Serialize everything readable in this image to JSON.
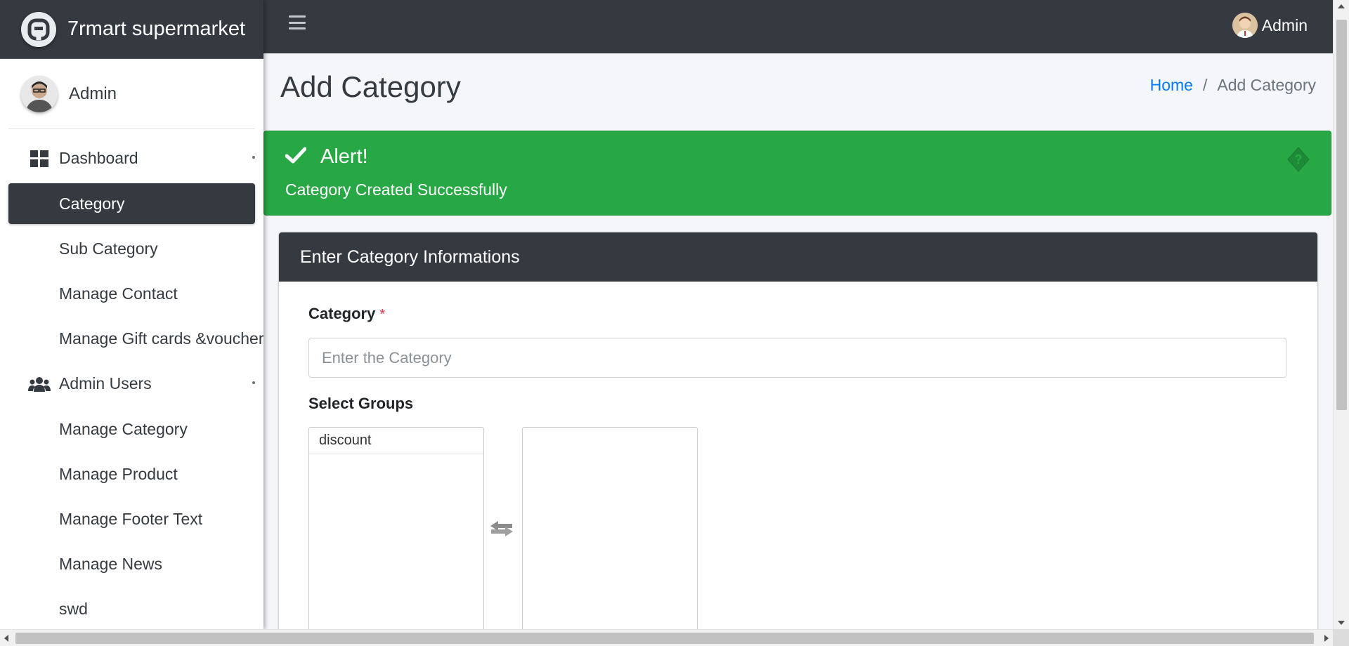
{
  "brand": {
    "name": "7rmart supermarket"
  },
  "sidebar": {
    "user_name": "Admin",
    "items": [
      {
        "label": "Dashboard",
        "icon": "dashboard-icon",
        "has_caret": true
      },
      {
        "label": "Category",
        "active": true
      },
      {
        "label": "Sub Category"
      },
      {
        "label": "Manage Contact"
      },
      {
        "label": "Manage Gift cards &voucher"
      },
      {
        "label": "Admin Users",
        "icon": "users-icon",
        "has_caret": true
      },
      {
        "label": "Manage Category"
      },
      {
        "label": "Manage Product"
      },
      {
        "label": "Manage Footer Text"
      },
      {
        "label": "Manage News"
      },
      {
        "label": "swd"
      }
    ]
  },
  "topbar": {
    "user_name": "Admin",
    "menu_icon": "hamburger-icon"
  },
  "page": {
    "title": "Add Category",
    "breadcrumb": {
      "home": "Home",
      "separator": "/",
      "current": "Add Category"
    }
  },
  "alert": {
    "title": "Alert!",
    "message": "Category Created Successfully",
    "color": "#28a745"
  },
  "form": {
    "card_title": "Enter Category Informations",
    "category_label": "Category",
    "required_mark": "*",
    "category_placeholder": "Enter the Category",
    "category_value": "",
    "groups_label": "Select Groups",
    "available_groups": [
      "discount"
    ],
    "selected_groups": []
  },
  "colors": {
    "dark": "#343a40",
    "success": "#28a745",
    "link": "#007bff",
    "required": "#dc3545",
    "background": "#f4f6f9"
  }
}
